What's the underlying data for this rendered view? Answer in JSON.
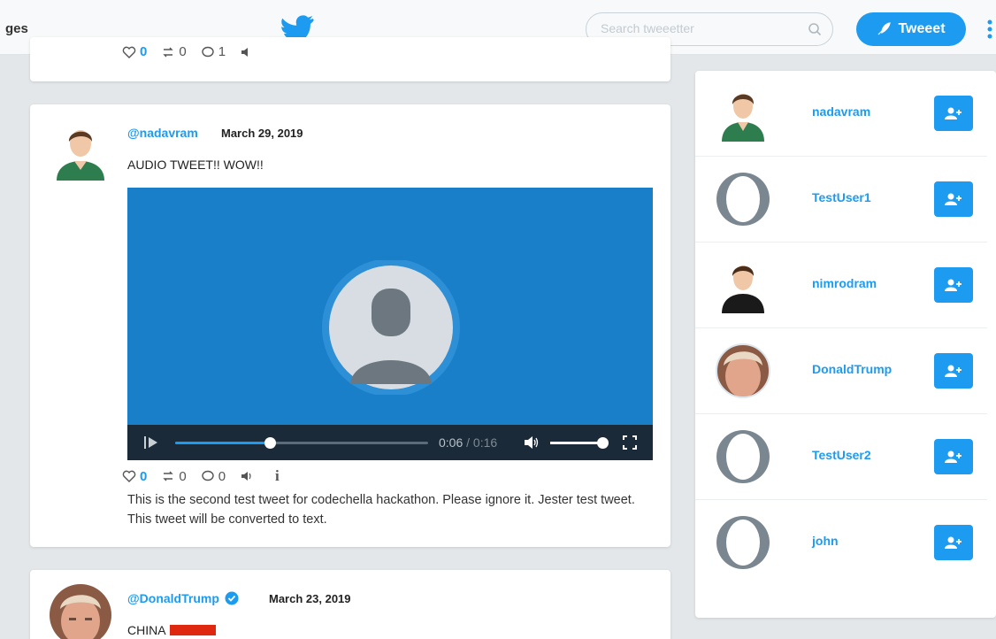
{
  "nav": {
    "partial_text": "ges"
  },
  "search": {
    "placeholder": "Search tweeetter"
  },
  "tweet_button": {
    "label": "Tweeet"
  },
  "top_card": {
    "likes": "0",
    "retweets": "0",
    "replies": "1"
  },
  "audio_tweet": {
    "handle": "@nadavram",
    "date": "March 29, 2019",
    "text": "AUDIO TWEET!! WOW!!",
    "player": {
      "current_time": "0:06",
      "separator": "/",
      "duration": "0:16",
      "progress_fraction": 0.375,
      "volume_fraction": 1.0
    },
    "likes": "0",
    "retweets": "0",
    "replies": "0",
    "info_label": "i",
    "transcript": "This is the second test tweet for codechella hackathon. Please ignore it. Jester test tweet. This tweet will be converted to text."
  },
  "trump_tweet": {
    "handle": "@DonaldTrump",
    "date": "March 23, 2019",
    "text": "CHINA"
  },
  "who_to_follow": [
    {
      "name": "nadavram",
      "avatar": "avatar-green-shirt"
    },
    {
      "name": "TestUser1",
      "avatar": "avatar-default-ring"
    },
    {
      "name": "nimrodram",
      "avatar": "avatar-black-shirt"
    },
    {
      "name": "DonaldTrump",
      "avatar": "avatar-photo"
    },
    {
      "name": "TestUser2",
      "avatar": "avatar-default-ring"
    },
    {
      "name": "john",
      "avatar": "avatar-default-ring"
    }
  ],
  "colors": {
    "accent": "#1d9bf0",
    "player_bg": "#1a7fc9",
    "controls_bg": "#1b2a38"
  }
}
